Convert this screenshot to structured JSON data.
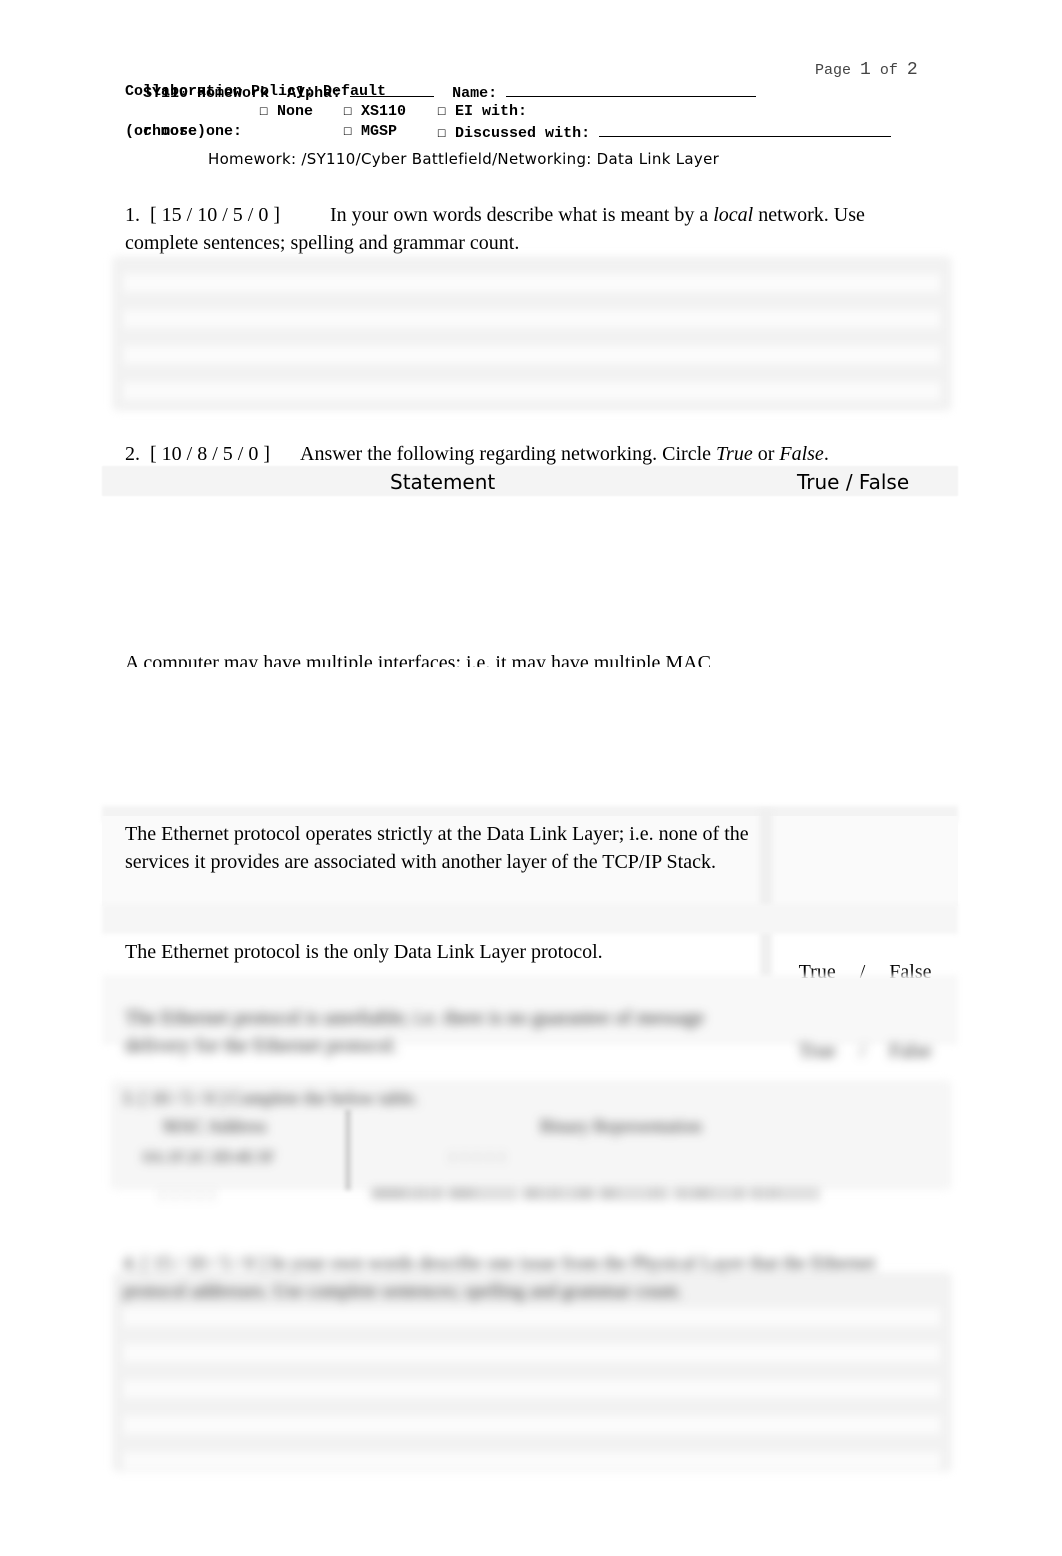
{
  "header": {
    "course_title": "SY110 Homework",
    "alpha_label": "Alpha:",
    "alpha_value": "",
    "name_label": "Name:",
    "name_value": "",
    "page_label": "Page",
    "page_current": "1",
    "page_of": "of",
    "page_total": "2",
    "collab_label": "Collaboration Policy: Default",
    "choose_label": "choose one:",
    "or_more_label": "(or more)",
    "options": [
      {
        "box": "☐",
        "label": "None"
      },
      {
        "box": "☐",
        "label": "XS110"
      },
      {
        "box": "☐",
        "label": "EI with:"
      },
      {
        "box": "☐",
        "label": "MGSP"
      },
      {
        "box": "☐",
        "label": "Discussed with:"
      }
    ],
    "discussed_value": "",
    "subtitle": "Homework: /SY110/Cyber Battlefield/Networking: Data Link Layer"
  },
  "q1": {
    "number": "1.",
    "points": "[ 15 / 10 / 5 / 0 ]",
    "text_before": "In your own words describe what is meant by a ",
    "text_italic": "local",
    "text_after": " network. Use complete sentences; spelling and grammar count."
  },
  "q2": {
    "number": "2.",
    "points": "[ 10 / 8 / 5 / 0 ]",
    "text_before": "Answer the following regarding networking. Circle ",
    "italic_true": "True",
    "text_or": " or ",
    "italic_false": "False",
    "text_end": ".",
    "col_statement": "Statement",
    "col_tf": "True / False",
    "rows": [
      {
        "statement": "A computer may have multiple interfaces; i.e. it may have multiple MAC",
        "tf": ""
      },
      {
        "statement": "The Ethernet protocol operates strictly at the Data Link Layer; i.e. none of the services it provides are associated with another layer of the TCP/IP Stack.",
        "tf": ""
      },
      {
        "statement": "The Ethernet protocol is the only Data Link Layer protocol.",
        "tf_true": "True",
        "tf_sep": "/",
        "tf_false": "False"
      },
      {
        "statement": "The Ethernet protocol is unreliable; i.e. there is no guarantee of message delivery for the Ethernet protocol.",
        "tf_true": "True",
        "tf_sep": "/",
        "tf_false": "False"
      }
    ]
  },
  "q3": {
    "heading": "3. [ 10 / 5 / 0 ]   Complete the below table.",
    "col_mac": "MAC Address",
    "col_binary": "Binary Representation",
    "mac_value": "0A:1F:2C:3D:4E:5F",
    "binary_placeholder": ":  :  :  :  :",
    "mac_placeholder": ":  :  :  :  :",
    "binary_value": "00001010 00011111 00101100 00111101 01001110 01011111"
  },
  "q4": {
    "heading": "4. [ 15 / 10 / 5 / 0 ]   In your own words describe one issue from the Physical Layer that the Ethernet protocol addresses. Use complete sentences; spelling and grammar count."
  }
}
